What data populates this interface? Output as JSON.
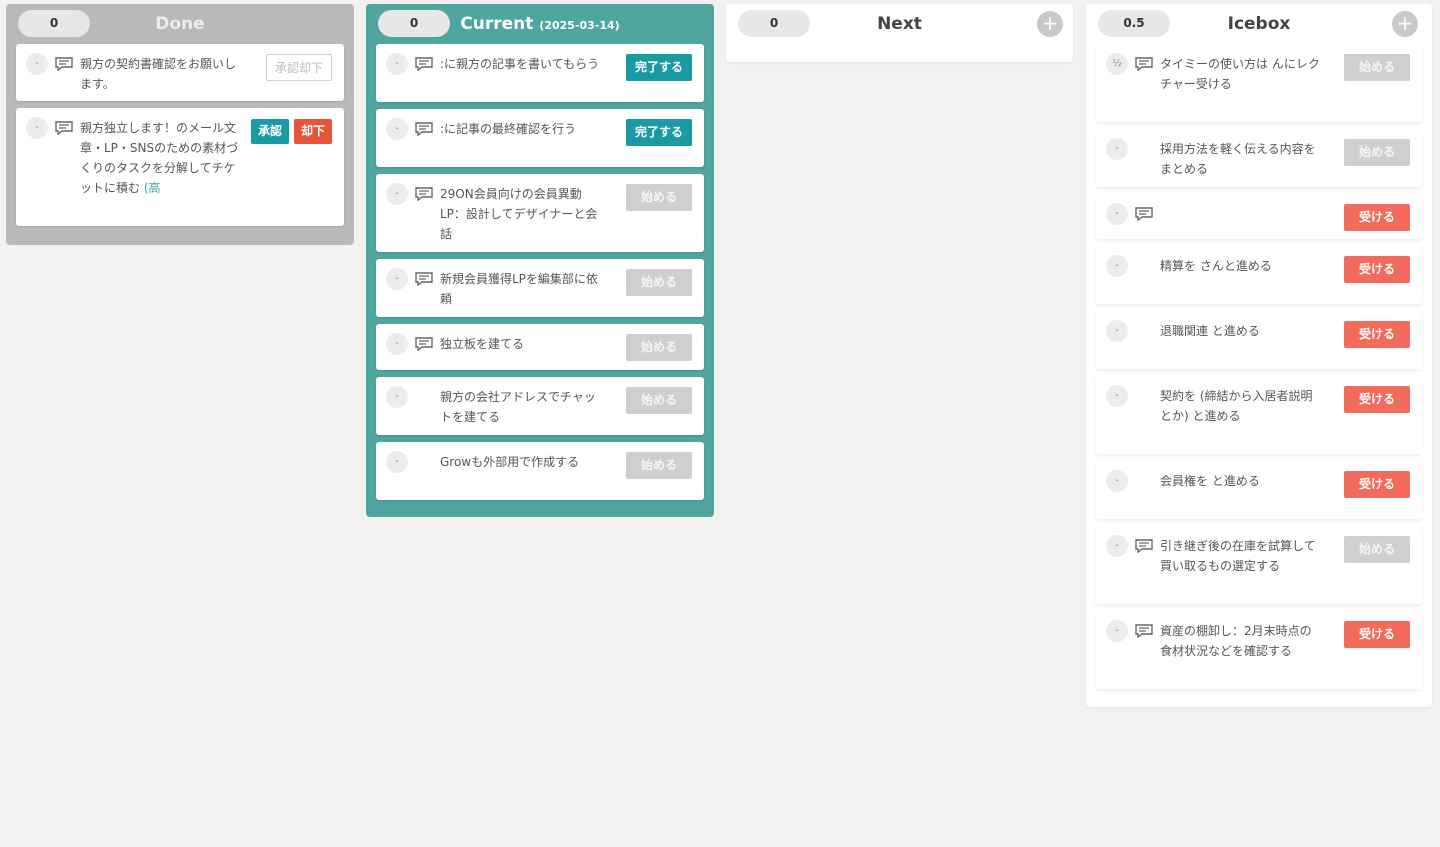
{
  "columns": {
    "done": {
      "title": "Done",
      "points": "0",
      "cards": [
        {
          "estimate": "-",
          "text": "親方の契約書確認をお願いします。",
          "button": "承認却下"
        },
        {
          "estimate": "-",
          "text": "親方独立します！のメール文章・LP・SNSのための素材づくりのタスクを分解してチケットに積む",
          "link": "(高",
          "accept": "承認",
          "reject": "却下"
        }
      ]
    },
    "current": {
      "title": "Current",
      "date": "(2025-03-14)",
      "points": "0",
      "cards": [
        {
          "estimate": "-",
          "text": ":に親方の記事を書いてもらう",
          "button": "完了する"
        },
        {
          "estimate": "-",
          "text": ":に記事の最終確認を行う",
          "button": "完了する"
        },
        {
          "estimate": "-",
          "text": "29ON会員向けの会員異動LP：設計してデザイナーと会話",
          "button": "始める"
        },
        {
          "estimate": "-",
          "text": "新規会員獲得LPを編集部に依頼",
          "button": "始める"
        },
        {
          "estimate": "-",
          "text": "独立板を建てる",
          "button": "始める"
        },
        {
          "estimate": "-",
          "text": "親方の会社アドレスでチャットを建てる",
          "button": "始める"
        },
        {
          "estimate": "-",
          "text": "Growも外部用で作成する",
          "button": "始める"
        }
      ]
    },
    "next": {
      "title": "Next",
      "points": "0",
      "add_label": "+"
    },
    "icebox": {
      "title": "Icebox",
      "points": "0.5",
      "add_label": "+",
      "cards": [
        {
          "estimate": "½",
          "text": "タイミーの使い方は んにレクチャー受ける",
          "button": "始める"
        },
        {
          "estimate": "-",
          "text": "採用方法を軽く伝える内容をまとめる",
          "button": "始める"
        },
        {
          "estimate": "-",
          "text": "",
          "button": "受ける"
        },
        {
          "estimate": "-",
          "text": "精算を さんと進める",
          "button": "受ける"
        },
        {
          "estimate": "-",
          "text": "退職関連 と進める",
          "button": "受ける"
        },
        {
          "estimate": "-",
          "text": "契約を (締結から入居者説明とか) と進める",
          "button": "受ける"
        },
        {
          "estimate": "-",
          "text": "会員権を と進める",
          "button": "受ける"
        },
        {
          "estimate": "-",
          "text": "引き継ぎ後の在庫を試算して買い取るもの選定する",
          "button": "始める"
        },
        {
          "estimate": "-",
          "text": "資産の棚卸し：2月末時点の食材状況などを確認する",
          "button": "受ける"
        }
      ]
    }
  },
  "icons": {
    "comment": "comment-icon",
    "add": "plus-icon"
  },
  "colors": {
    "current": "#4ea69f",
    "done": "#b9b9b9",
    "teal_button": "#1a9aa3",
    "red_button": "#f36b5d",
    "gray_button": "#cfcfcf"
  }
}
